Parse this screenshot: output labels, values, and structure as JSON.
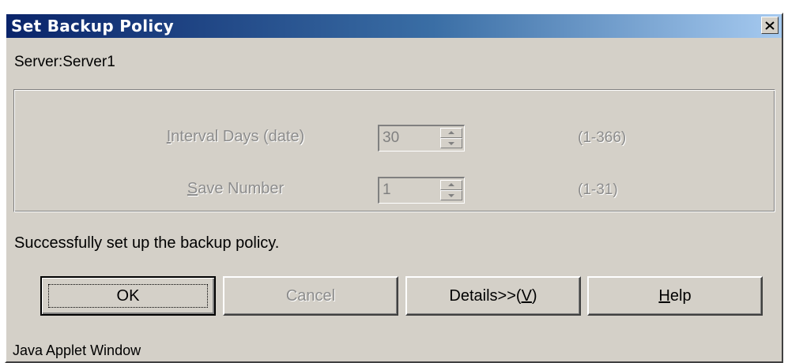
{
  "window": {
    "title": "Set Backup Policy",
    "close_glyph": "×",
    "icons": {
      "close": "close-icon"
    }
  },
  "server_label": "Server:Server1",
  "policy": {
    "interval_days": {
      "label": "Interval Days (date)",
      "value": "30",
      "range": "(1-366)",
      "enabled": false
    },
    "save_number": {
      "label": "Save Number",
      "value": "1",
      "range": "(1-31)",
      "enabled": false
    }
  },
  "status_message": "Successfully set up the backup policy.",
  "buttons": {
    "ok": "OK",
    "cancel": "Cancel",
    "details": "Details>>(V)",
    "help": "Help"
  },
  "footer": "Java Applet Window",
  "colors": {
    "title_start": "#0a246a",
    "title_end": "#a6caf0",
    "face": "#d4d0c8",
    "disabled_text": "#8c8c8c"
  }
}
